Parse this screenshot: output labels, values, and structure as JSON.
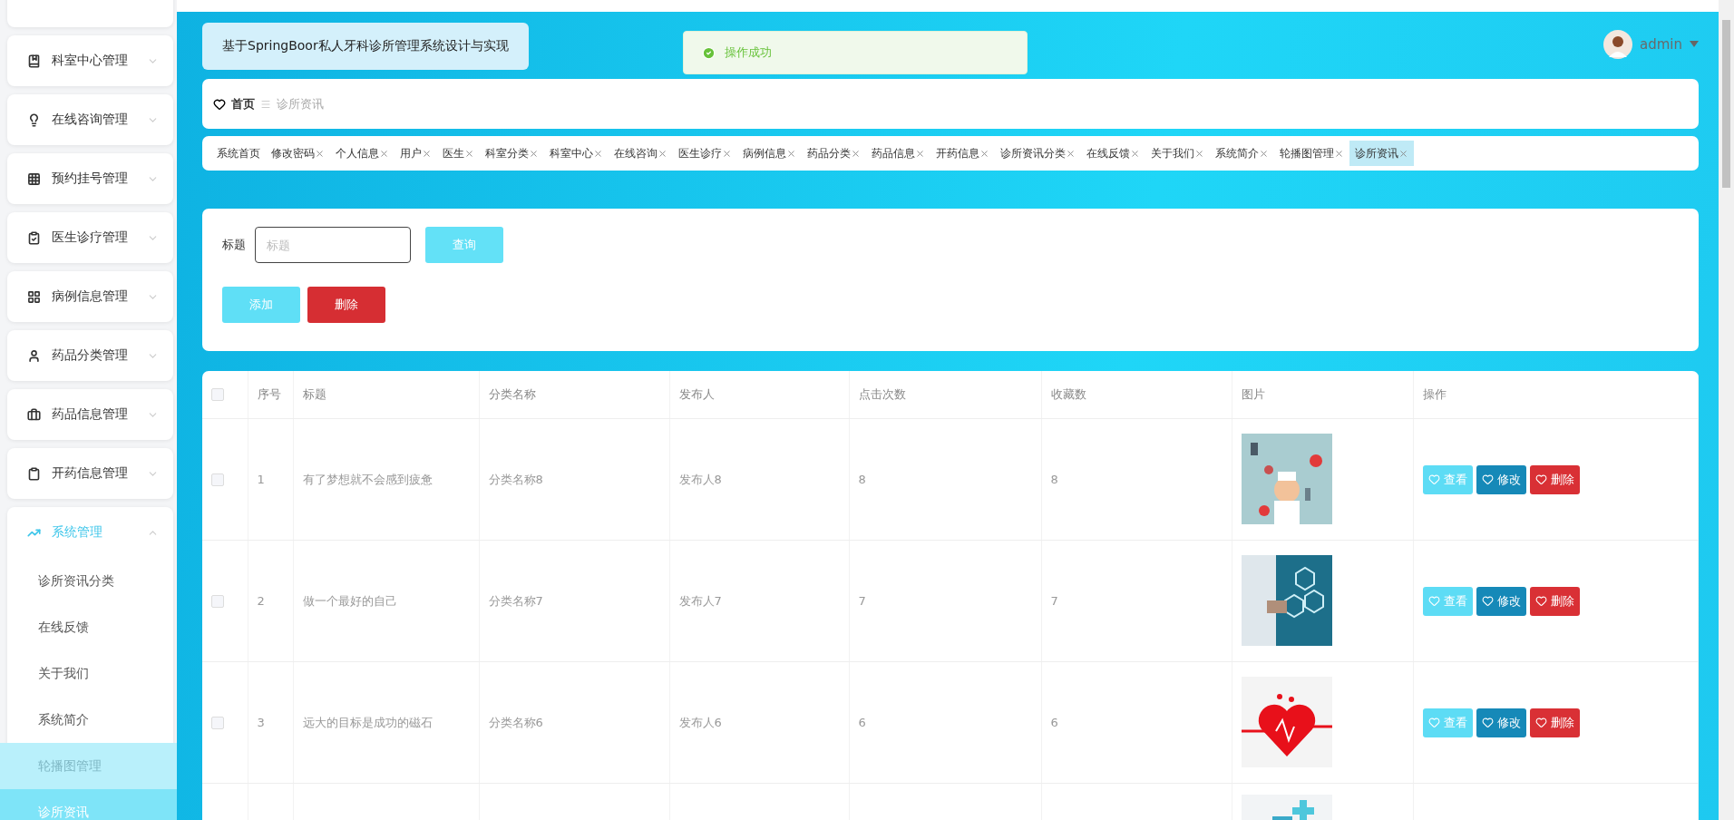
{
  "sidebar": {
    "items": [
      {
        "label": "科室中心管理",
        "expanded": false
      },
      {
        "label": "在线咨询管理",
        "expanded": false
      },
      {
        "label": "预约挂号管理",
        "expanded": false
      },
      {
        "label": "医生诊疗管理",
        "expanded": false
      },
      {
        "label": "病例信息管理",
        "expanded": false
      },
      {
        "label": "药品分类管理",
        "expanded": false
      },
      {
        "label": "药品信息管理",
        "expanded": false
      },
      {
        "label": "开药信息管理",
        "expanded": false
      },
      {
        "label": "系统管理",
        "expanded": true,
        "children": [
          {
            "label": "诊所资讯分类",
            "selected": false,
            "hovered": false
          },
          {
            "label": "在线反馈",
            "selected": false,
            "hovered": false
          },
          {
            "label": "关于我们",
            "selected": false,
            "hovered": false
          },
          {
            "label": "系统简介",
            "selected": false,
            "hovered": false
          },
          {
            "label": "轮播图管理",
            "selected": false,
            "hovered": true
          },
          {
            "label": "诊所资讯",
            "selected": true,
            "hovered": false
          }
        ]
      }
    ]
  },
  "header": {
    "title": "基于SpringBoor私人牙科诊所管理系统设计与实现",
    "toast": "操作成功",
    "user": "admin"
  },
  "breadcrumb": {
    "home": "首页",
    "current": "诊所资讯"
  },
  "tags": [
    {
      "label": "系统首页",
      "closable": false,
      "selected": false
    },
    {
      "label": "修改密码",
      "closable": true,
      "selected": false
    },
    {
      "label": "个人信息",
      "closable": true,
      "selected": false
    },
    {
      "label": "用户",
      "closable": true,
      "selected": false
    },
    {
      "label": "医生",
      "closable": true,
      "selected": false
    },
    {
      "label": "科室分类",
      "closable": true,
      "selected": false
    },
    {
      "label": "科室中心",
      "closable": true,
      "selected": false
    },
    {
      "label": "在线咨询",
      "closable": true,
      "selected": false
    },
    {
      "label": "医生诊疗",
      "closable": true,
      "selected": false
    },
    {
      "label": "病例信息",
      "closable": true,
      "selected": false
    },
    {
      "label": "药品分类",
      "closable": true,
      "selected": false
    },
    {
      "label": "药品信息",
      "closable": true,
      "selected": false
    },
    {
      "label": "开药信息",
      "closable": true,
      "selected": false
    },
    {
      "label": "诊所资讯分类",
      "closable": true,
      "selected": false
    },
    {
      "label": "在线反馈",
      "closable": true,
      "selected": false
    },
    {
      "label": "关于我们",
      "closable": true,
      "selected": false
    },
    {
      "label": "系统简介",
      "closable": true,
      "selected": false
    },
    {
      "label": "轮播图管理",
      "closable": true,
      "selected": false
    },
    {
      "label": "诊所资讯",
      "closable": true,
      "selected": true
    }
  ],
  "search": {
    "label": "标题",
    "placeholder": "标题",
    "query_button": "查询",
    "add_button": "添加",
    "delete_button": "删除"
  },
  "table": {
    "select_all_checked": false,
    "columns": [
      "序号",
      "标题",
      "分类名称",
      "发布人",
      "点击次数",
      "收藏数",
      "图片",
      "操作"
    ],
    "rows": [
      {
        "checked": false,
        "index": "1",
        "title": "有了梦想就不会感到疲惫",
        "category": "分类名称8",
        "publisher": "发布人8",
        "clicks": "8",
        "favorites": "8",
        "picture": {
          "kind": "picture"
        },
        "actions": [
          "查看",
          "修改",
          "删除"
        ]
      },
      {
        "checked": false,
        "index": "2",
        "title": "做一个最好的自己",
        "category": "分类名称7",
        "publisher": "发布人7",
        "clicks": "7",
        "favorites": "7",
        "picture": {
          "kind": "picture"
        },
        "actions": [
          "查看",
          "修改",
          "删除"
        ]
      },
      {
        "checked": false,
        "index": "3",
        "title": "远大的目标是成功的磁石",
        "category": "分类名称6",
        "publisher": "发布人6",
        "clicks": "6",
        "favorites": "6",
        "picture": {
          "kind": "picture"
        },
        "actions": [
          "查看",
          "修改",
          "删除"
        ]
      },
      {
        "picture": {
          "kind": "picture"
        }
      }
    ]
  }
}
